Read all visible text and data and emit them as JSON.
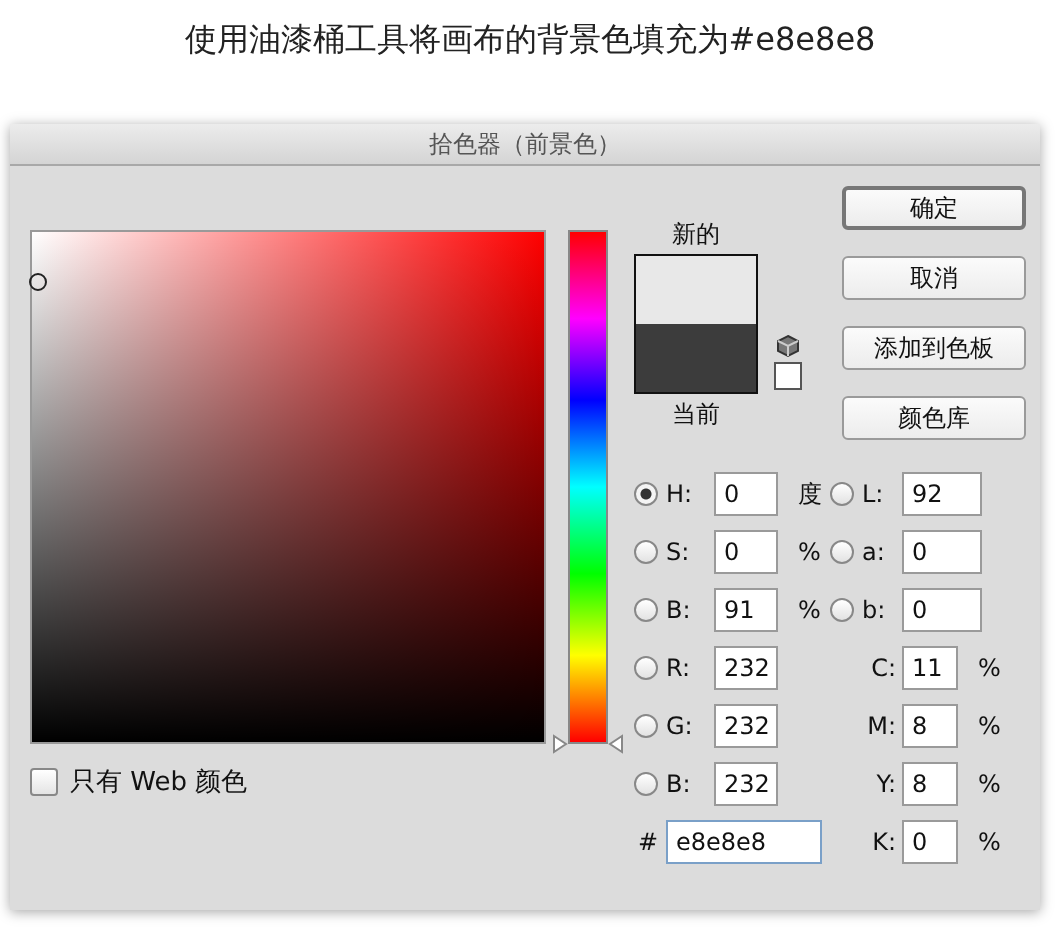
{
  "caption": "使用油漆桶工具将画布的背景色填充为#e8e8e8",
  "window": {
    "title": "拾色器（前景色）"
  },
  "preview": {
    "new_label": "新的",
    "current_label": "当前",
    "swatches": [
      {
        "color": "#e8e8e8"
      },
      {
        "color": "#3c3c3c"
      }
    ]
  },
  "buttons": [
    {
      "label": "确定",
      "default": true
    },
    {
      "label": "取消",
      "default": false
    },
    {
      "label": "添加到色板",
      "default": false
    },
    {
      "label": "颜色库",
      "default": false
    }
  ],
  "hsb_rgb": [
    {
      "label": "H:",
      "value": "0",
      "unit": "度",
      "selected": true
    },
    {
      "label": "S:",
      "value": "0",
      "unit": "%",
      "selected": false
    },
    {
      "label": "B:",
      "value": "91",
      "unit": "%",
      "selected": false
    },
    {
      "label": "R:",
      "value": "232",
      "selected": false
    },
    {
      "label": "G:",
      "value": "232",
      "selected": false
    },
    {
      "label": "B:",
      "value": "232",
      "selected": false
    }
  ],
  "lab": [
    {
      "label": "L:",
      "value": "92",
      "selected": false
    },
    {
      "label": "a:",
      "value": "0",
      "selected": false
    },
    {
      "label": "b:",
      "value": "0",
      "selected": false
    }
  ],
  "cmyk": [
    {
      "label": "C:",
      "value": "11",
      "unit": "%"
    },
    {
      "label": "M:",
      "value": "8",
      "unit": "%"
    },
    {
      "label": "Y:",
      "value": "8",
      "unit": "%"
    },
    {
      "label": "K:",
      "value": "0",
      "unit": "%"
    }
  ],
  "hex": {
    "label": "#",
    "value": "e8e8e8"
  },
  "hue_slider": {
    "level": 0
  },
  "web_only": {
    "label": "只有 Web 颜色",
    "checked": false
  }
}
